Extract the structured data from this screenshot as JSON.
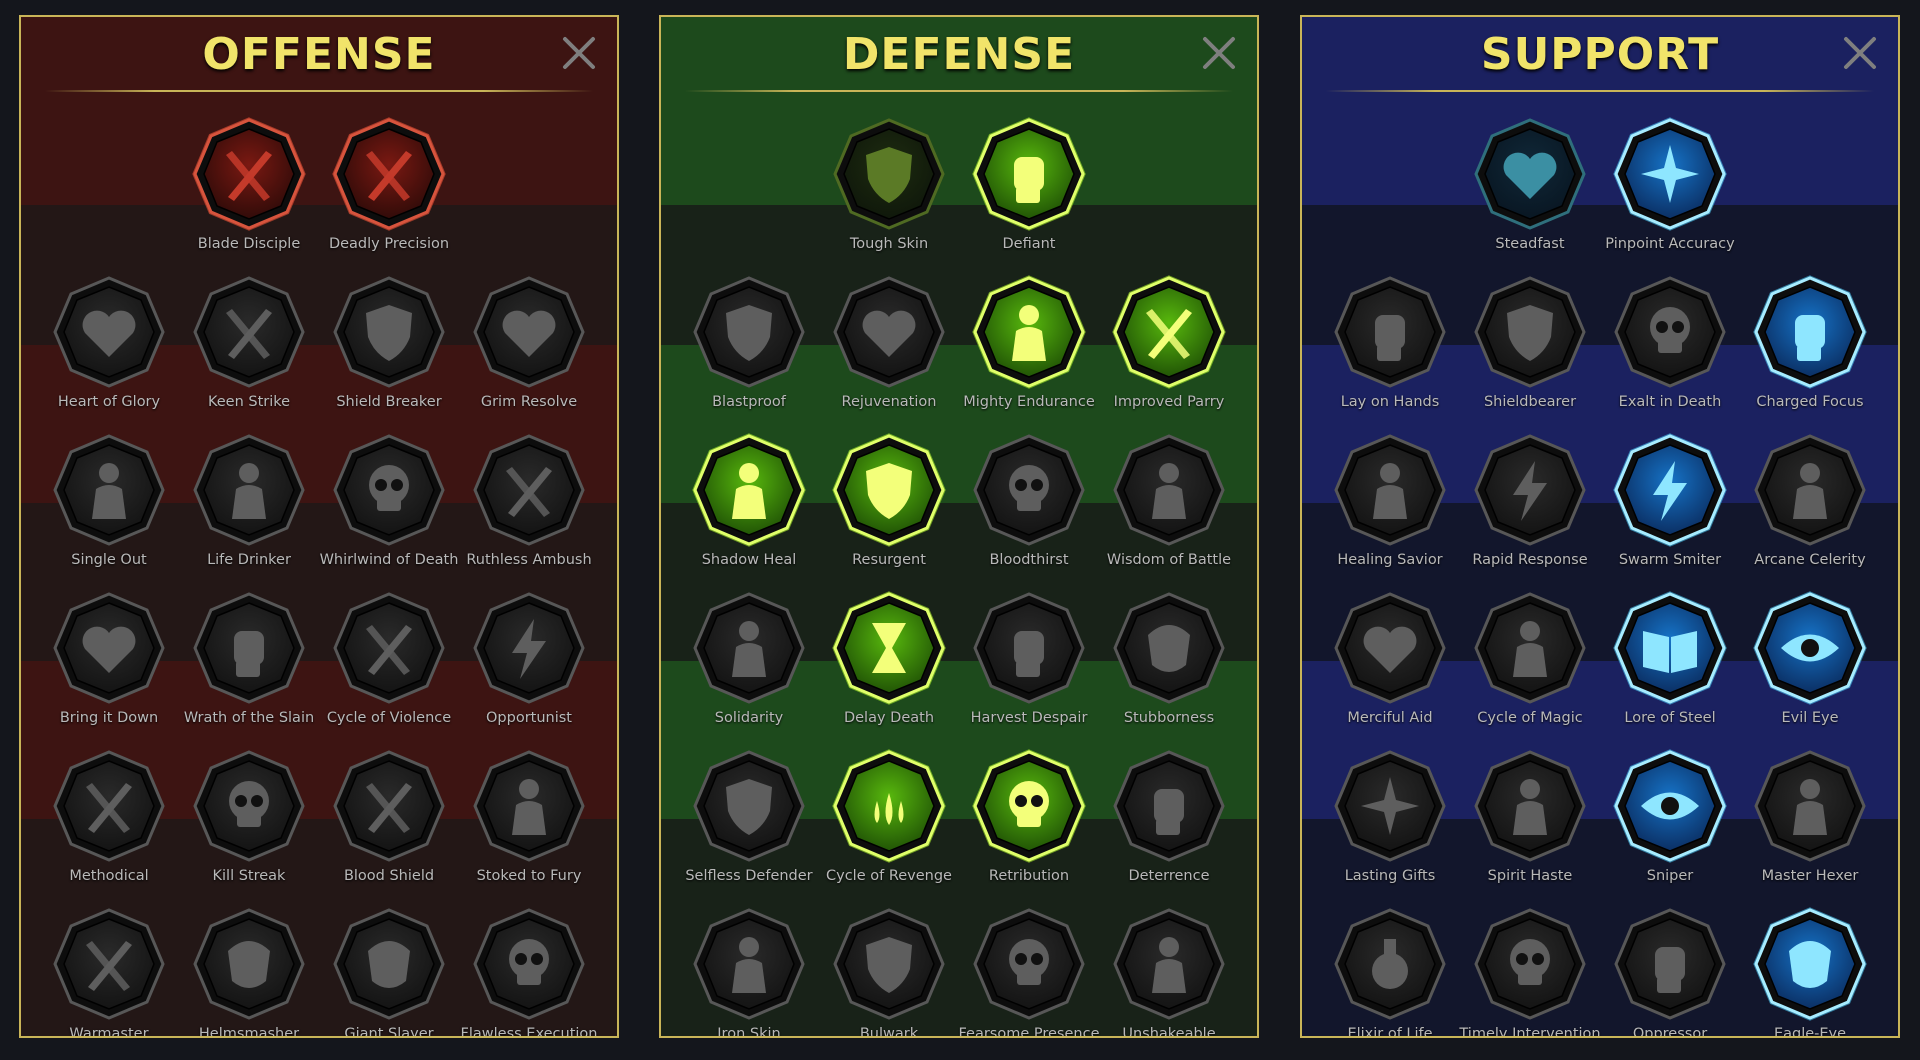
{
  "panels": [
    {
      "id": "offense",
      "title": "OFFENSE",
      "rows": [
        [
          {
            "name": "Blade Disciple",
            "icon": "crossed-swords-icon",
            "state": "owned-offense"
          },
          {
            "name": "Deadly Precision",
            "icon": "claw-slash-icon",
            "state": "owned-offense"
          }
        ],
        [
          {
            "name": "Heart of Glory",
            "icon": "horned-heart-icon",
            "state": "locked"
          },
          {
            "name": "Keen Strike",
            "icon": "slash-strike-icon",
            "state": "locked"
          },
          {
            "name": "Shield Breaker",
            "icon": "broken-shield-icon",
            "state": "locked"
          },
          {
            "name": "Grim Resolve",
            "icon": "dripping-heart-icon",
            "state": "locked"
          }
        ],
        [
          {
            "name": "Single Out",
            "icon": "pierced-figure-icon",
            "state": "locked"
          },
          {
            "name": "Life Drinker",
            "icon": "fangs-icon",
            "state": "locked"
          },
          {
            "name": "Whirlwind of Death",
            "icon": "skull-whirl-icon",
            "state": "locked"
          },
          {
            "name": "Ruthless Ambush",
            "icon": "dagger-hand-icon",
            "state": "locked"
          }
        ],
        [
          {
            "name": "Bring it Down",
            "icon": "heart-sword-icon",
            "state": "locked"
          },
          {
            "name": "Wrath of the Slain",
            "icon": "grasping-hand-icon",
            "state": "locked"
          },
          {
            "name": "Cycle of Violence",
            "icon": "axe-cycle-icon",
            "state": "locked"
          },
          {
            "name": "Opportunist",
            "icon": "chains-lightning-icon",
            "state": "locked"
          }
        ],
        [
          {
            "name": "Methodical",
            "icon": "triple-blades-icon",
            "state": "locked"
          },
          {
            "name": "Kill Streak",
            "icon": "skull-pair-icon",
            "state": "locked"
          },
          {
            "name": "Blood Shield",
            "icon": "sword-shield-icon",
            "state": "locked"
          },
          {
            "name": "Stoked to Fury",
            "icon": "raging-figure-icon",
            "state": "locked"
          }
        ],
        [
          {
            "name": "Warmaster",
            "icon": "sword-stars-icon",
            "state": "locked"
          },
          {
            "name": "Helmsmasher",
            "icon": "broken-helm-icon",
            "state": "locked"
          },
          {
            "name": "Giant Slayer",
            "icon": "giant-icon",
            "state": "locked"
          },
          {
            "name": "Flawless Execution",
            "icon": "execution-skull-icon",
            "state": "locked"
          }
        ]
      ]
    },
    {
      "id": "defense",
      "title": "DEFENSE",
      "rows": [
        [
          {
            "name": "Tough Skin",
            "icon": "armor-plates-icon",
            "state": "dim-defense"
          },
          {
            "name": "Defiant",
            "icon": "raised-fist-icon",
            "state": "owned-defense"
          }
        ],
        [
          {
            "name": "Blastproof",
            "icon": "shield-layers-icon",
            "state": "locked"
          },
          {
            "name": "Rejuvenation",
            "icon": "heart-organ-icon",
            "state": "locked"
          },
          {
            "name": "Mighty Endurance",
            "icon": "strong-figure-icon",
            "state": "owned-defense"
          },
          {
            "name": "Improved Parry",
            "icon": "parry-blades-icon",
            "state": "owned-defense"
          }
        ],
        [
          {
            "name": "Shadow Heal",
            "icon": "shadow-figure-icon",
            "state": "owned-defense"
          },
          {
            "name": "Resurgent",
            "icon": "knight-shield-icon",
            "state": "owned-defense"
          },
          {
            "name": "Bloodthirst",
            "icon": "skull-heart-icon",
            "state": "locked"
          },
          {
            "name": "Wisdom of Battle",
            "icon": "hooded-figure-icon",
            "state": "locked"
          }
        ],
        [
          {
            "name": "Solidarity",
            "icon": "crowd-icon",
            "state": "locked"
          },
          {
            "name": "Delay Death",
            "icon": "hourglass-icon",
            "state": "owned-defense"
          },
          {
            "name": "Harvest Despair",
            "icon": "spread-hand-icon",
            "state": "locked"
          },
          {
            "name": "Stubborness",
            "icon": "bull-head-icon",
            "state": "locked"
          }
        ],
        [
          {
            "name": "Selfless Defender",
            "icon": "runner-shield-icon",
            "state": "locked"
          },
          {
            "name": "Cycle of Revenge",
            "icon": "blood-drops-icon",
            "state": "owned-defense"
          },
          {
            "name": "Retribution",
            "icon": "radiant-skull-icon",
            "state": "owned-defense"
          },
          {
            "name": "Deterrence",
            "icon": "warding-hand-icon",
            "state": "locked"
          }
        ],
        [
          {
            "name": "Iron Skin",
            "icon": "iron-warrior-icon",
            "state": "locked"
          },
          {
            "name": "Bulwark",
            "icon": "bulwark-shield-icon",
            "state": "locked"
          },
          {
            "name": "Fearsome Presence",
            "icon": "skull-shadow-icon",
            "state": "locked"
          },
          {
            "name": "Unshakeable",
            "icon": "flexing-figure-icon",
            "state": "locked"
          }
        ]
      ]
    },
    {
      "id": "support",
      "title": "SUPPORT",
      "rows": [
        [
          {
            "name": "Steadfast",
            "icon": "heart-plus-icon",
            "state": "dim-support"
          },
          {
            "name": "Pinpoint Accuracy",
            "icon": "target-burst-icon",
            "state": "owned-support"
          }
        ],
        [
          {
            "name": "Lay on Hands",
            "icon": "praying-hands-icon",
            "state": "locked"
          },
          {
            "name": "Shieldbearer",
            "icon": "shield-rings-icon",
            "state": "locked"
          },
          {
            "name": "Exalt in Death",
            "icon": "flaming-skull-icon",
            "state": "locked"
          },
          {
            "name": "Charged Focus",
            "icon": "charged-hand-icon",
            "state": "owned-support"
          }
        ],
        [
          {
            "name": "Healing Savior",
            "icon": "healer-figure-icon",
            "state": "locked"
          },
          {
            "name": "Rapid Response",
            "icon": "lightning-bolt-icon",
            "state": "locked"
          },
          {
            "name": "Swarm Smiter",
            "icon": "zigzag-bolts-icon",
            "state": "owned-support"
          },
          {
            "name": "Arcane Celerity",
            "icon": "fast-figure-icon",
            "state": "locked"
          }
        ],
        [
          {
            "name": "Merciful Aid",
            "icon": "chained-heart-icon",
            "state": "locked"
          },
          {
            "name": "Cycle of Magic",
            "icon": "fireball-icon",
            "state": "locked"
          },
          {
            "name": "Lore of Steel",
            "icon": "open-book-icon",
            "state": "owned-support"
          },
          {
            "name": "Evil Eye",
            "icon": "angry-eyes-icon",
            "state": "owned-support"
          }
        ],
        [
          {
            "name": "Lasting Gifts",
            "icon": "compass-star-icon",
            "state": "locked"
          },
          {
            "name": "Spirit Haste",
            "icon": "winged-boot-icon",
            "state": "locked"
          },
          {
            "name": "Sniper",
            "icon": "eye-icon",
            "state": "owned-support"
          },
          {
            "name": "Master Hexer",
            "icon": "voodoo-doll-icon",
            "state": "locked"
          }
        ],
        [
          {
            "name": "Elixir of Life",
            "icon": "potion-flask-icon",
            "state": "locked"
          },
          {
            "name": "Timely Intervention",
            "icon": "winged-skull-icon",
            "state": "locked"
          },
          {
            "name": "Oppressor",
            "icon": "crushing-fist-icon",
            "state": "locked"
          },
          {
            "name": "Eagle-Eye",
            "icon": "eagle-head-icon",
            "state": "owned-support"
          }
        ]
      ]
    }
  ],
  "colors": {
    "title": "#f1e46a",
    "frame": "#c9b558",
    "owned_offense": "#c0261d",
    "owned_defense": "#9cf21a",
    "owned_support": "#29b6f6",
    "locked": "#3a3a3a"
  }
}
